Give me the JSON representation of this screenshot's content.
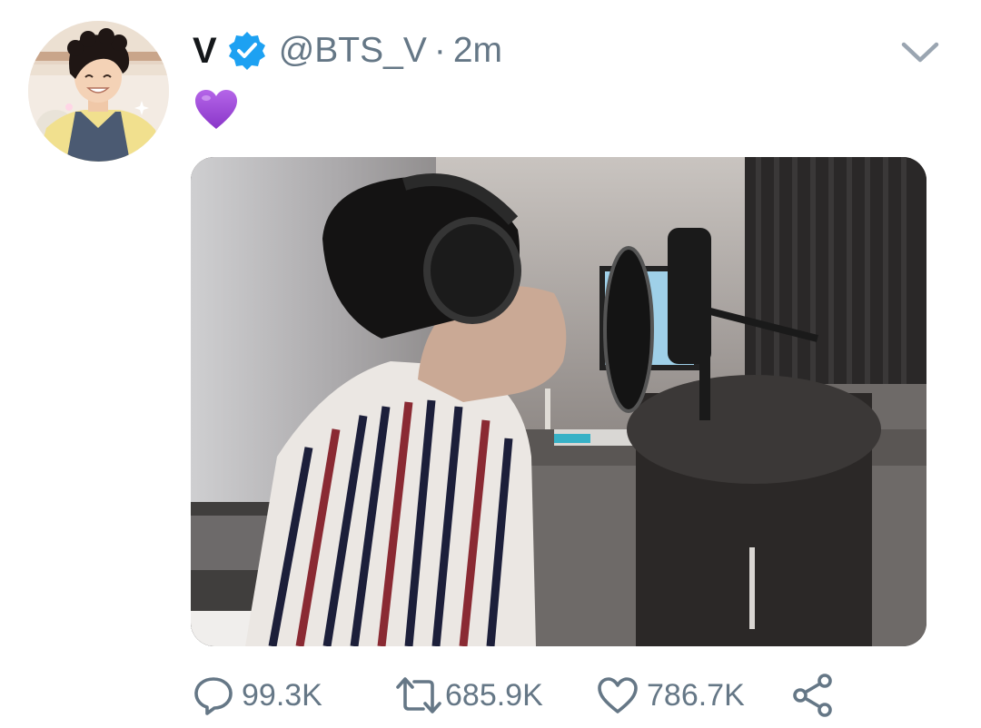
{
  "tweet": {
    "display_name": "V",
    "handle": "@BTS_V",
    "separator": "·",
    "timestamp": "2m",
    "body_emoji": "purple-heart",
    "verified": true
  },
  "actions": {
    "reply_count": "99.3K",
    "retweet_count": "685.9K",
    "like_count": "786.7K"
  },
  "icons": {
    "verified": "verified-badge-icon",
    "caret": "chevron-down-icon",
    "reply": "reply-icon",
    "retweet": "retweet-icon",
    "like": "heart-icon",
    "share": "share-icon"
  },
  "colors": {
    "verified_blue": "#1da1f2",
    "secondary_text": "#657786",
    "heart_purple": "#9b47d6"
  }
}
